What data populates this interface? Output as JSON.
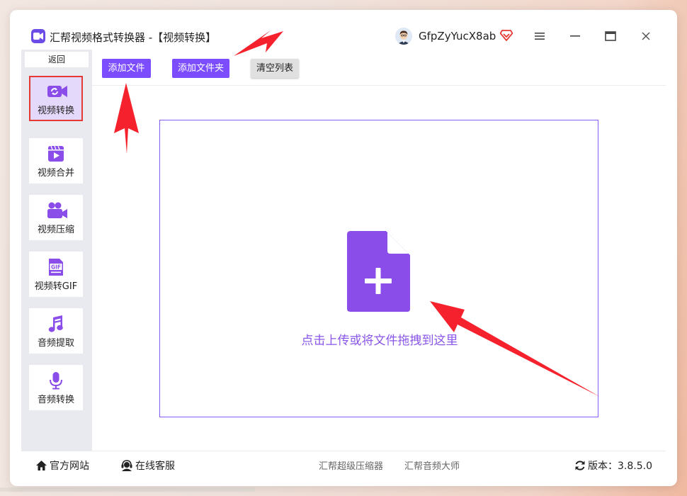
{
  "window": {
    "title": "汇帮视频格式转换器 -【视频转换】",
    "username": "GfpZyYucX8ab"
  },
  "sidebar": {
    "back_label": "返回",
    "items": [
      {
        "label": "视频转换",
        "icon": "video-convert-icon",
        "active": true
      },
      {
        "label": "视频合并",
        "icon": "video-merge-icon"
      },
      {
        "label": "视频压缩",
        "icon": "video-compress-icon"
      },
      {
        "label": "视频转GIF",
        "icon": "gif-icon"
      },
      {
        "label": "音频提取",
        "icon": "music-note-icon"
      },
      {
        "label": "音频转换",
        "icon": "microphone-icon"
      }
    ]
  },
  "toolbar": {
    "add_file": "添加文件",
    "add_folder": "添加文件夹",
    "clear_list": "清空列表"
  },
  "dropzone": {
    "text": "点击上传或将文件拖拽到这里",
    "icon": "file-add-icon"
  },
  "footer": {
    "official_site": "官方网站",
    "online_service": "在线客服",
    "link1": "汇帮超级压缩器",
    "link2": "汇帮音频大师",
    "version": "版本：3.8.5.0"
  },
  "colors": {
    "accent": "#7c4dff",
    "active_bg": "#e4d8fb",
    "highlight_border": "#e53935",
    "annotation_arrow": "#f5222d"
  }
}
